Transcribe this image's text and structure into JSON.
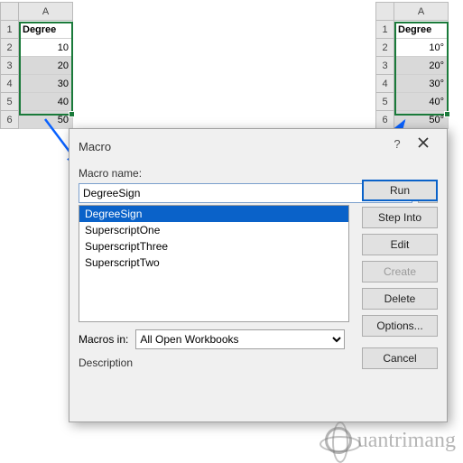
{
  "sheets": {
    "left": {
      "col_header": "A",
      "rows": [
        "1",
        "2",
        "3",
        "4",
        "5",
        "6"
      ],
      "header_cell": "Degree",
      "values": [
        "10",
        "20",
        "30",
        "40",
        "50"
      ]
    },
    "right": {
      "col_header": "A",
      "rows": [
        "1",
        "2",
        "3",
        "4",
        "5",
        "6"
      ],
      "header_cell": "Degree",
      "values": [
        "10°",
        "20°",
        "30°",
        "40°",
        "50°"
      ]
    }
  },
  "dialog": {
    "title": "Macro",
    "help_label": "?",
    "name_label": "Macro name:",
    "name_value": "DegreeSign",
    "list": [
      "DegreeSign",
      "SuperscriptOne",
      "SuperscriptThree",
      "SuperscriptTwo"
    ],
    "buttons": {
      "run": "Run",
      "step_into": "Step Into",
      "edit": "Edit",
      "create": "Create",
      "delete": "Delete",
      "options": "Options...",
      "cancel": "Cancel"
    },
    "macros_in_label": "Macros in:",
    "macros_in_value": "All Open Workbooks",
    "description_label": "Description"
  },
  "watermark": "uantrimang"
}
